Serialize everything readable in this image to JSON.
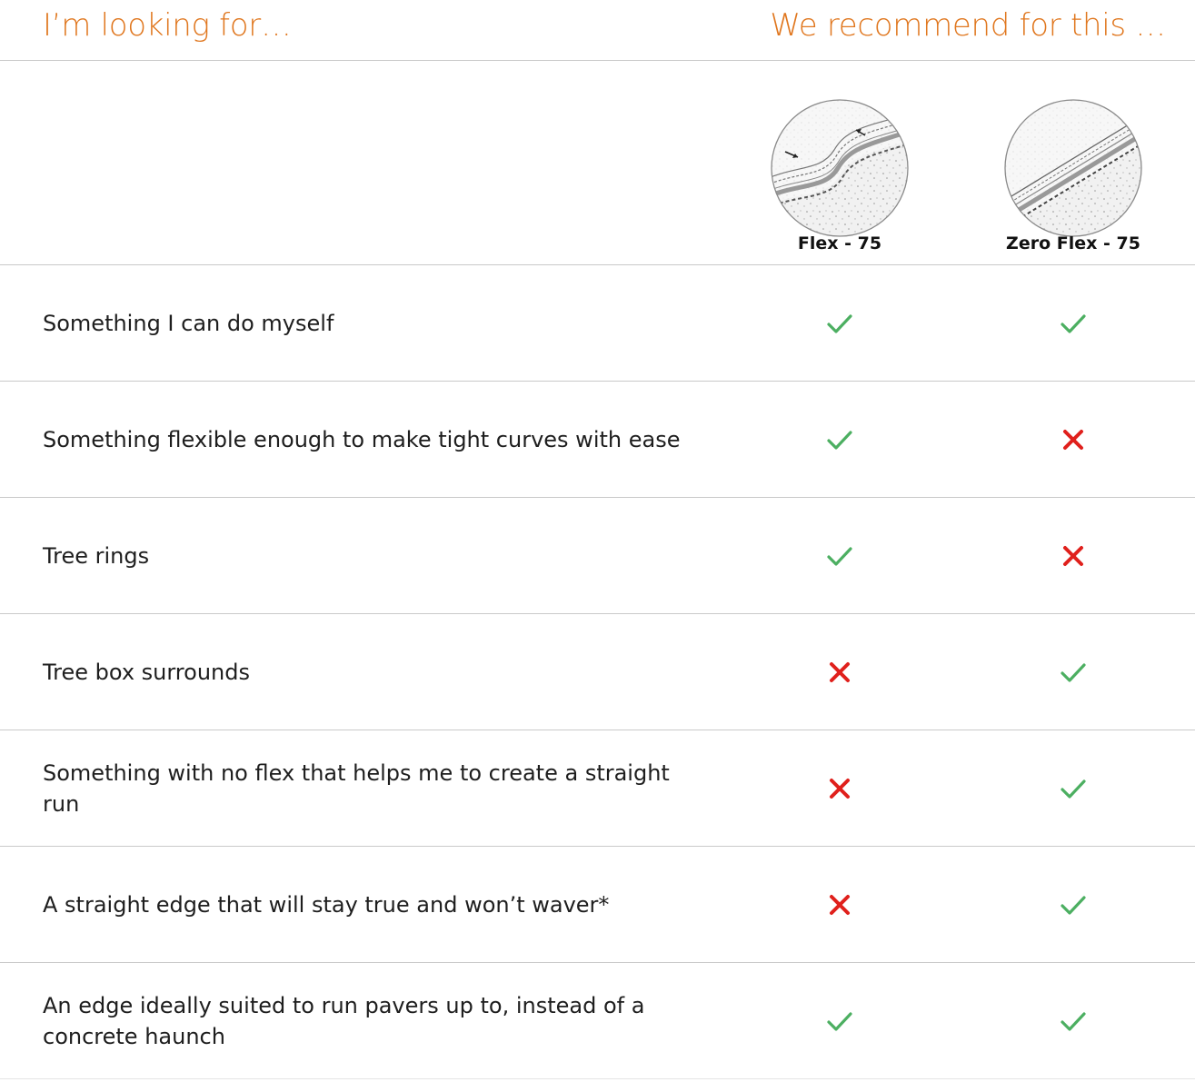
{
  "header": {
    "left_title": "I’m looking for…",
    "right_title": "We recommend for this …"
  },
  "products": [
    {
      "name": "Flex - 75",
      "icon": "flex-edging-illustration-icon"
    },
    {
      "name": "Zero Flex - 75",
      "icon": "zero-flex-edging-illustration-icon"
    }
  ],
  "colors": {
    "accent": "#e0771f",
    "check": "#4caf61",
    "cross": "#e0201c",
    "divider": "#c9c9c9"
  },
  "rows": [
    {
      "label": "Something I can do myself",
      "flex": "yes",
      "zero_flex": "yes"
    },
    {
      "label": "Something flexible enough to make tight curves with ease",
      "flex": "yes",
      "zero_flex": "no"
    },
    {
      "label": "Tree rings",
      "flex": "yes",
      "zero_flex": "no"
    },
    {
      "label": "Tree box surrounds",
      "flex": "no",
      "zero_flex": "yes"
    },
    {
      "label": "Something with no flex that helps me to create a straight run",
      "flex": "no",
      "zero_flex": "yes"
    },
    {
      "label": "A straight edge that will stay true and won’t waver*",
      "flex": "no",
      "zero_flex": "yes"
    },
    {
      "label": "An edge ideally suited to run pavers up to, instead of a concrete haunch",
      "flex": "yes",
      "zero_flex": "yes"
    }
  ]
}
